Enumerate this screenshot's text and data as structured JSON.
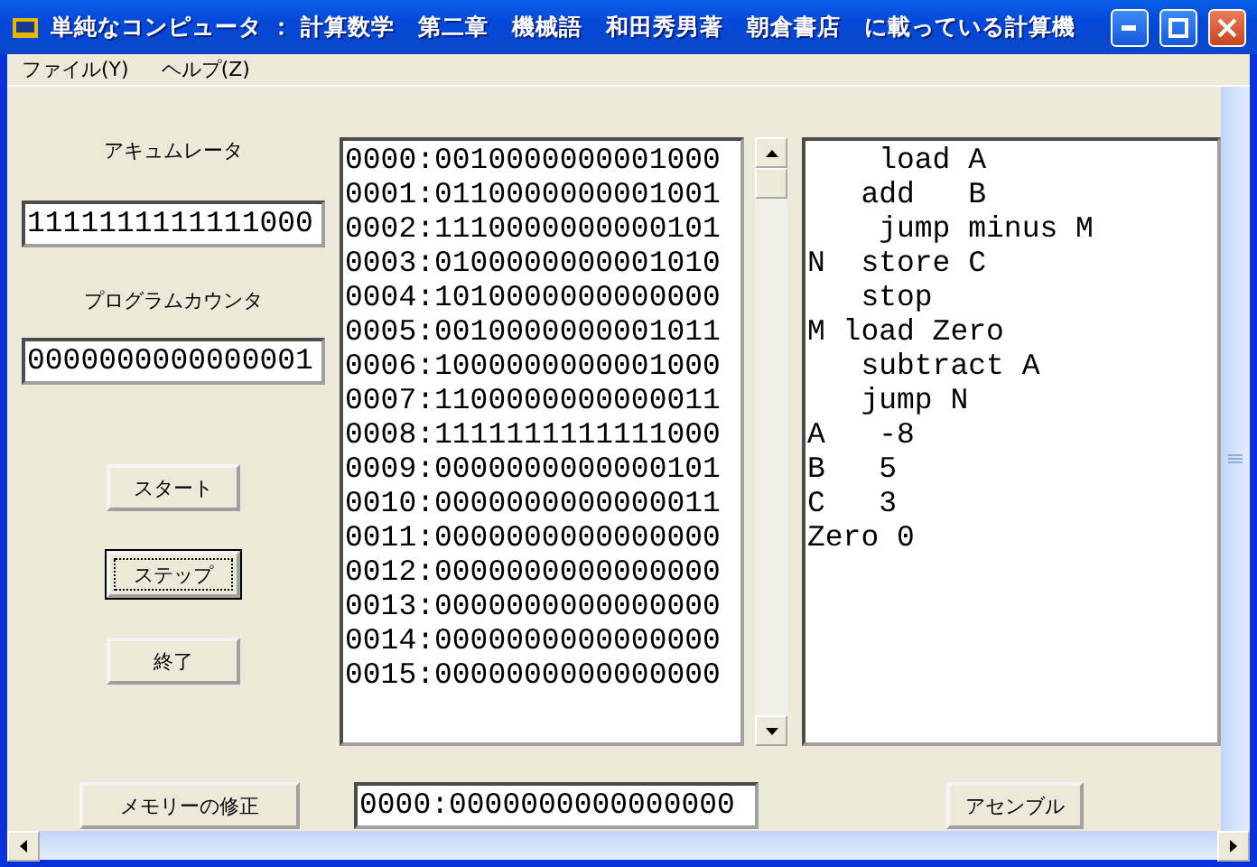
{
  "window": {
    "title": "単純なコンピュータ ： 計算数学　第二章　機械語　和田秀男著　朝倉書店　に載っている計算機"
  },
  "menu": [
    "ファイル(Y)",
    "ヘルプ(Z)"
  ],
  "registers": [
    {
      "label": "アキュムレータ",
      "value": "1111111111111000"
    },
    {
      "label": "プログラムカウンタ",
      "value": "0000000000000001"
    }
  ],
  "buttons": [
    {
      "label": "スタート",
      "focused": false
    },
    {
      "label": "ステップ",
      "focused": true
    },
    {
      "label": "終了",
      "focused": false
    }
  ],
  "memory": [
    "0000:0010000000001000",
    "0001:0110000000001001",
    "0002:1110000000000101",
    "0003:0100000000001010",
    "0004:1010000000000000",
    "0005:0010000000001011",
    "0006:1000000000001000",
    "0007:1100000000000011",
    "0008:1111111111111000",
    "0009:0000000000000101",
    "0010:0000000000000011",
    "0011:0000000000000000",
    "0012:0000000000000000",
    "0013:0000000000000000",
    "0014:0000000000000000",
    "0015:0000000000000000"
  ],
  "source": [
    "    load A",
    "   add   B",
    "    jump minus M",
    "N  store C",
    "   stop",
    "M load Zero",
    "   subtract A",
    "   jump N",
    "A   -8",
    "B   5",
    "C   3",
    "Zero 0"
  ],
  "bottom": {
    "memory_button": "メモリーの修正",
    "memory_field": "0000:0000000000000000",
    "assemble_button": "アセンブル"
  }
}
